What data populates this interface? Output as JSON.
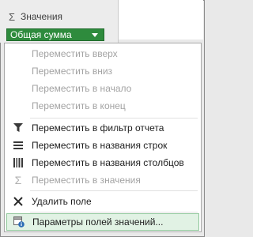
{
  "values_panel": {
    "title": "Значения",
    "field": "Общая сумма"
  },
  "menu": {
    "items": [
      {
        "label": "Переместить вверх",
        "enabled": false,
        "icon": "none"
      },
      {
        "label": "Переместить вниз",
        "enabled": false,
        "icon": "none"
      },
      {
        "label": "Переместить в начало",
        "enabled": false,
        "icon": "none"
      },
      {
        "label": "Переместить в конец",
        "enabled": false,
        "icon": "none"
      },
      {
        "label": "Переместить в фильтр отчета",
        "enabled": true,
        "icon": "filter-icon"
      },
      {
        "label": "Переместить в названия строк",
        "enabled": true,
        "icon": "rows-icon"
      },
      {
        "label": "Переместить в названия столбцов",
        "enabled": true,
        "icon": "columns-icon"
      },
      {
        "label": "Переместить в значения",
        "enabled": false,
        "icon": "sigma-icon"
      },
      {
        "label": "Удалить поле",
        "enabled": true,
        "icon": "remove-icon"
      },
      {
        "label": "Параметры полей значений...",
        "enabled": true,
        "icon": "field-settings-icon",
        "highlighted": true
      }
    ]
  },
  "colors": {
    "pill_bg": "#2e8b3d",
    "highlight_bg": "#e1f2e4",
    "highlight_border": "#8fc79a",
    "disabled_text": "#a3a3a3"
  }
}
